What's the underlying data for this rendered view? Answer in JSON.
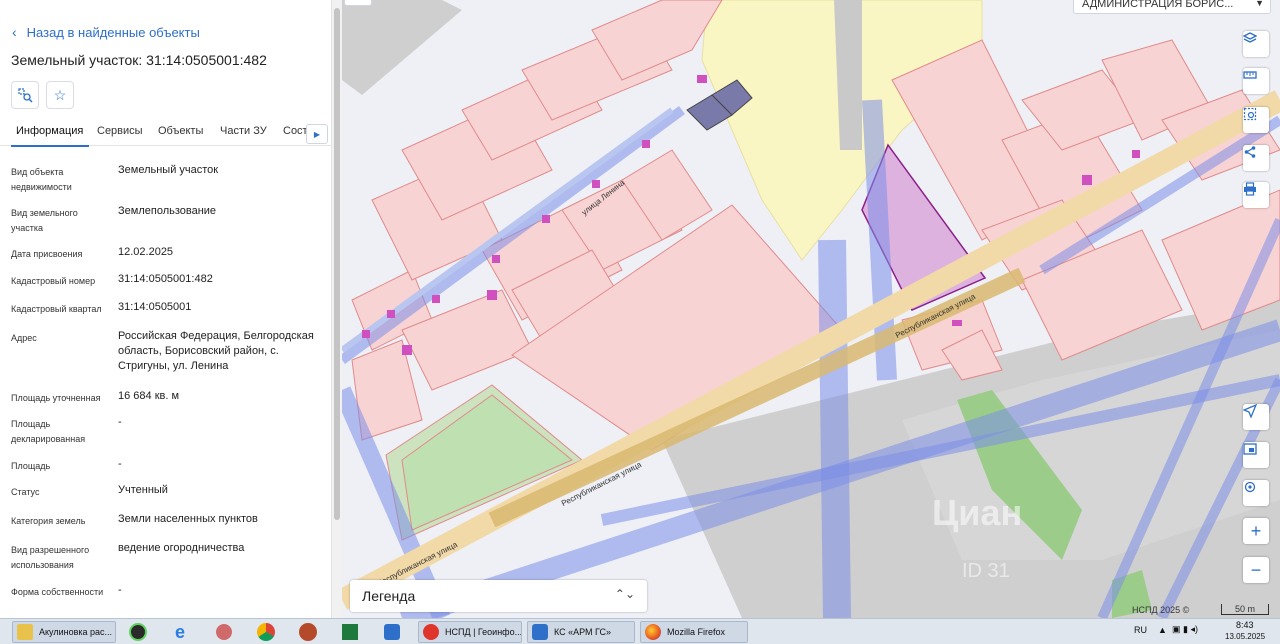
{
  "panel": {
    "back_label": "Назад в найденные объекты",
    "title": "Земельный участок: 31:14:0505001:482",
    "tabs": [
      {
        "label": "Информация"
      },
      {
        "label": "Сервисы"
      },
      {
        "label": "Объекты"
      },
      {
        "label": "Части ЗУ"
      },
      {
        "label": "Соста"
      }
    ],
    "rows": [
      {
        "key": "Вид объекта недвижимости",
        "value": "Земельный участок"
      },
      {
        "key": "Вид земельного участка",
        "value": "Землепользование"
      },
      {
        "key": "Дата присвоения",
        "value": "12.02.2025"
      },
      {
        "key": "Кадастровый номер",
        "value": "31:14:0505001:482"
      },
      {
        "key": "Кадастровый квартал",
        "value": "31:14:0505001"
      },
      {
        "key": "Адрес",
        "value": "Российская Федерация, Белгородская область, Борисовский район, с. Стригуны, ул. Ленина"
      },
      {
        "key": "Площадь уточненная",
        "value": "16 684 кв. м"
      },
      {
        "key": "Площадь декларированная",
        "value": "-"
      },
      {
        "key": "Площадь",
        "value": "-"
      },
      {
        "key": "Статус",
        "value": "Учтенный"
      },
      {
        "key": "Категория земель",
        "value": "Земли населенных пунктов"
      },
      {
        "key": "Вид разрешенного использования",
        "value": "ведение огородничества"
      },
      {
        "key": "Форма собственности",
        "value": "-"
      }
    ]
  },
  "map": {
    "admin_select": "АДМИНИСТРАЦИЯ БОРИС...",
    "legend_label": "Легенда",
    "copyright": "НСПД 2025 ©",
    "scale_label": "50 m",
    "streets": {
      "lenina": "улица Ленина",
      "respub1": "Республиканская улица",
      "respub2": "Республиканская улица",
      "respub3": "Республиканская улица"
    },
    "watermark": "Циан",
    "watermark_id": "ID 31",
    "colors": {
      "parcel": "#f8d3d3",
      "parcel_stroke": "#e08a8a",
      "selected": "#d9a3d9",
      "selected_stroke": "#8a1f8a",
      "road_blue": "#7b8ee8",
      "road_main": "#e8c98a",
      "zone_yellow": "#faf6c4",
      "grey": "#c9c9c9",
      "green": "#9ccc8a"
    }
  },
  "taskbar": {
    "items": [
      {
        "label": "Акулиновка рас..."
      },
      {
        "label": "НСПД | Геоинфо..."
      },
      {
        "label": "КС «АРМ ГС»"
      },
      {
        "label": "Mozilla Firefox"
      }
    ],
    "lang": "RU",
    "time": "8:43",
    "date": "13.05.2025"
  }
}
